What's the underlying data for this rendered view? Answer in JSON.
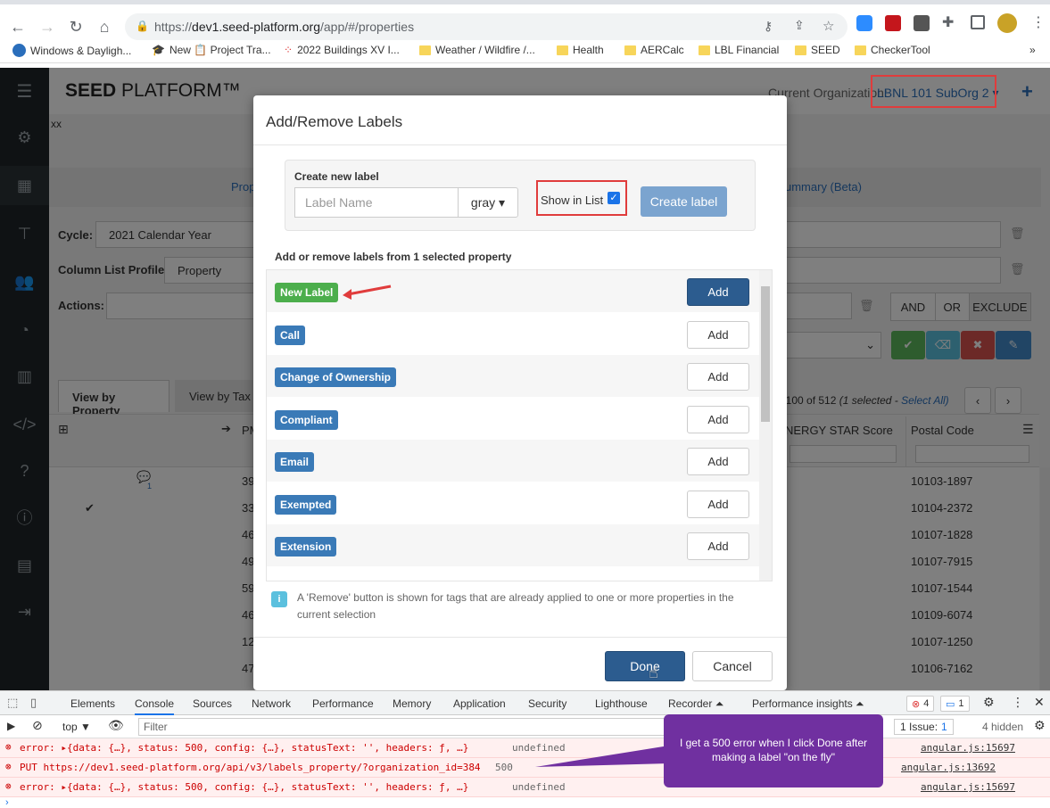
{
  "browser": {
    "url_prefix": "https://",
    "url_host": "dev1.seed-platform.org",
    "url_path": "/app/#/properties",
    "bookmarks": [
      {
        "label": "Windows & Dayligh..."
      },
      {
        "label": "New 📋 Project Tra..."
      },
      {
        "label": "2022 Buildings XV I..."
      },
      {
        "label": "Weather / Wildfire /..."
      },
      {
        "label": "Health"
      },
      {
        "label": "AERCalc"
      },
      {
        "label": "LBL Financial"
      },
      {
        "label": "SEED"
      },
      {
        "label": "CheckerTool"
      }
    ],
    "more": "»"
  },
  "app": {
    "brand_bold": "SEED",
    "brand_rest": " PLATFORM™",
    "org_label": "Current Organization:",
    "org_value": "LBNL 101 SubOrg 2",
    "xx": "xx",
    "tab_partial": "Prop",
    "summary_tab": "ummary (Beta)",
    "cycle_label": "Cycle:",
    "cycle_value": "2021 Calendar Year",
    "column_profile_label": "Column List Profile:",
    "column_profile_value": "Property",
    "actions_label": "Actions:",
    "and": "AND",
    "or": "OR",
    "exclude": "EXCLUDE",
    "view_by_property": "View by Property",
    "view_by_tax": "View by Tax L",
    "pagination": "1-100 of 512",
    "selected": "(1 selected - ",
    "select_all": "Select All)",
    "col_pm": "PM",
    "col_energy": "NERGY STAR Score",
    "col_postal": "Postal Code",
    "postal_codes": [
      "10103-1897",
      "10104-2372",
      "10107-1828",
      "10107-7915",
      "10107-1544",
      "10109-6074",
      "10107-1250",
      "10106-7162"
    ],
    "pm_prefix": [
      "39",
      "33",
      "46",
      "49",
      "59",
      "46",
      "12",
      "47"
    ],
    "comment_count": "1"
  },
  "modal": {
    "title": "Add/Remove Labels",
    "create_heading": "Create new label",
    "label_placeholder": "Label Name",
    "color_value": "gray",
    "show_in_list": "Show in List",
    "create_button": "Create label",
    "list_heading": "Add or remove labels from 1 selected property",
    "labels": [
      {
        "name": "New Label",
        "color": "#4cae4c",
        "action": "Add",
        "primary": true
      },
      {
        "name": "Call",
        "color": "#3a7ab7",
        "action": "Add",
        "primary": false
      },
      {
        "name": "Change of Ownership",
        "color": "#3a7ab7",
        "action": "Add",
        "primary": false
      },
      {
        "name": "Compliant",
        "color": "#3a7ab7",
        "action": "Add",
        "primary": false
      },
      {
        "name": "Email",
        "color": "#3a7ab7",
        "action": "Add",
        "primary": false
      },
      {
        "name": "Exempted",
        "color": "#3a7ab7",
        "action": "Add",
        "primary": false
      },
      {
        "name": "Extension",
        "color": "#3a7ab7",
        "action": "Add",
        "primary": false
      }
    ],
    "info_text": "A 'Remove' button is shown for tags that are already applied to one or more properties in the current selection",
    "done": "Done",
    "cancel": "Cancel"
  },
  "devtools": {
    "tabs": [
      "Elements",
      "Console",
      "Sources",
      "Network",
      "Performance",
      "Memory",
      "Application",
      "Security",
      "Lighthouse",
      "Recorder ⏶",
      "Performance insights ⏶"
    ],
    "active_tab": "Console",
    "errors_count": "4",
    "messages_count": "1",
    "context": "top",
    "filter_placeholder": "Filter",
    "issues": "1 Issue:",
    "issues_count": "1",
    "hidden": "4 hidden",
    "rows": [
      {
        "text": "error: ▸{data: {…}, status: 500, config: {…}, statusText: '', headers: ƒ, …}",
        "suffix": "undefined",
        "source": "angular.js:15697"
      },
      {
        "text": "PUT https://dev1.seed-platform.org/api/v3/labels_property/?organization_id=384",
        "suffix": "500",
        "source": "angular.js:13692"
      },
      {
        "text": "error: ▸{data: {…}, status: 500, config: {…}, statusText: '', headers: ƒ, …}",
        "suffix": "undefined",
        "source": "angular.js:15697"
      }
    ],
    "callout": "I get a 500 error when I click Done after making a label \"on the fly\""
  },
  "colors": {
    "primary": "#2c5c8f",
    "success": "#4cae4c",
    "label_blue": "#3a7ab7",
    "annotation_red": "#e03c3c",
    "callout_purple": "#7030a0"
  }
}
